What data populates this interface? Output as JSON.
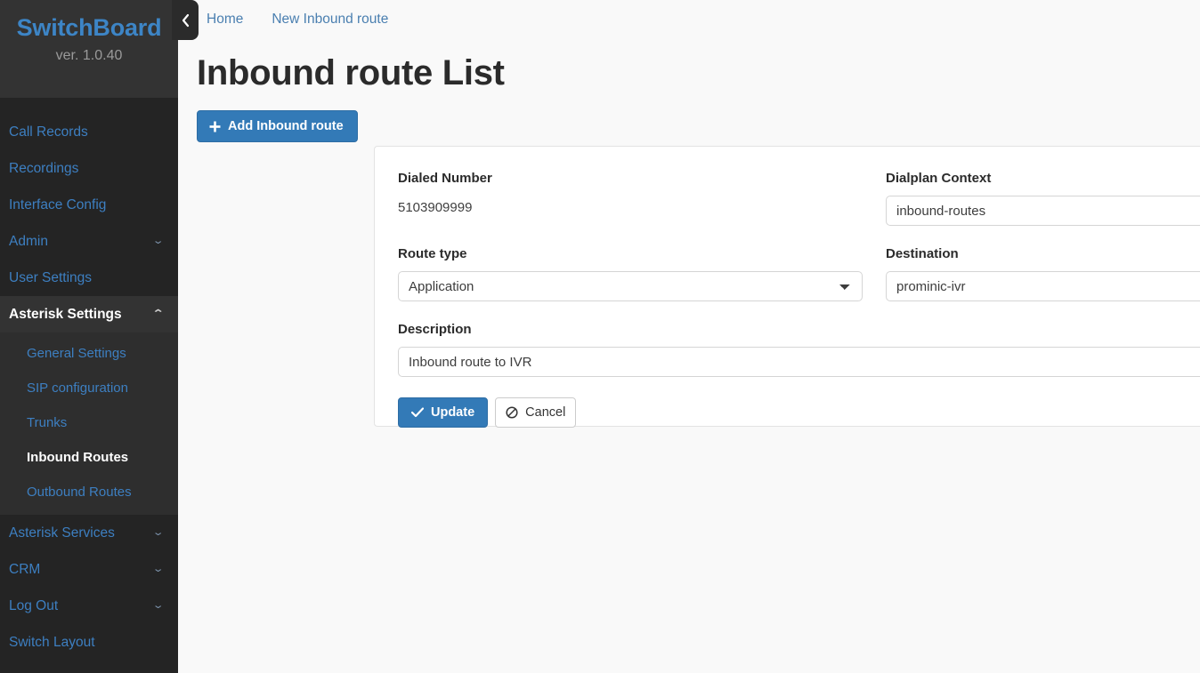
{
  "sidebar": {
    "brand": "SwitchBoard",
    "version": "ver. 1.0.40",
    "collapse_icon": "chevron-left-icon",
    "items": [
      {
        "label": "Call Records",
        "has_chevron": false,
        "active": false
      },
      {
        "label": "Recordings",
        "has_chevron": false,
        "active": false
      },
      {
        "label": "Interface Config",
        "has_chevron": false,
        "active": false
      },
      {
        "label": "Admin",
        "has_chevron": true,
        "chevron": "chevron-down-icon",
        "active": false
      },
      {
        "label": "User Settings",
        "has_chevron": false,
        "active": false
      },
      {
        "label": "Asterisk Settings",
        "has_chevron": true,
        "chevron": "chevron-up-icon",
        "active": true
      }
    ],
    "submenu": [
      {
        "label": "General Settings",
        "active": false
      },
      {
        "label": "SIP configuration",
        "active": false
      },
      {
        "label": "Trunks",
        "active": false
      },
      {
        "label": "Inbound Routes",
        "active": true
      },
      {
        "label": "Outbound Routes",
        "active": false
      }
    ],
    "items_after": [
      {
        "label": "Asterisk Services",
        "has_chevron": true,
        "chevron": "chevron-down-icon",
        "active": false
      },
      {
        "label": "CRM",
        "has_chevron": true,
        "chevron": "chevron-down-icon",
        "active": false
      },
      {
        "label": "Log Out",
        "has_chevron": true,
        "chevron": "chevron-down-icon",
        "active": false
      },
      {
        "label": "Switch Layout",
        "has_chevron": false,
        "active": false
      }
    ],
    "chevron_down_glyph": "⌄",
    "chevron_up_glyph": "⌃"
  },
  "topbar": {
    "home": "Home",
    "new_inbound_route": "New Inbound route"
  },
  "page": {
    "title": "Inbound route List",
    "add_button": "Add Inbound route",
    "add_button_icon": "plus-icon"
  },
  "form": {
    "dialed_number": {
      "label": "Dialed Number",
      "value": "5103909999"
    },
    "dialplan_context": {
      "label": "Dialplan Context",
      "value": "inbound-routes"
    },
    "route_type": {
      "label": "Route type",
      "value": "Application",
      "options": [
        "Application"
      ]
    },
    "destination": {
      "label": "Destination",
      "value": "prominic-ivr",
      "options": [
        "prominic-ivr"
      ]
    },
    "description": {
      "label": "Description",
      "value": "Inbound route to IVR"
    },
    "update_button": "Update",
    "update_button_icon": "check-icon",
    "cancel_button": "Cancel",
    "cancel_button_icon": "ban-icon"
  },
  "colors": {
    "accent_blue": "#337ab7",
    "link_blue": "#3d7fc1",
    "sidebar_bg": "#242424",
    "sidebar_header_bg": "#333333",
    "submenu_bg": "#2e2e2e",
    "page_bg": "#f9f9f9"
  }
}
